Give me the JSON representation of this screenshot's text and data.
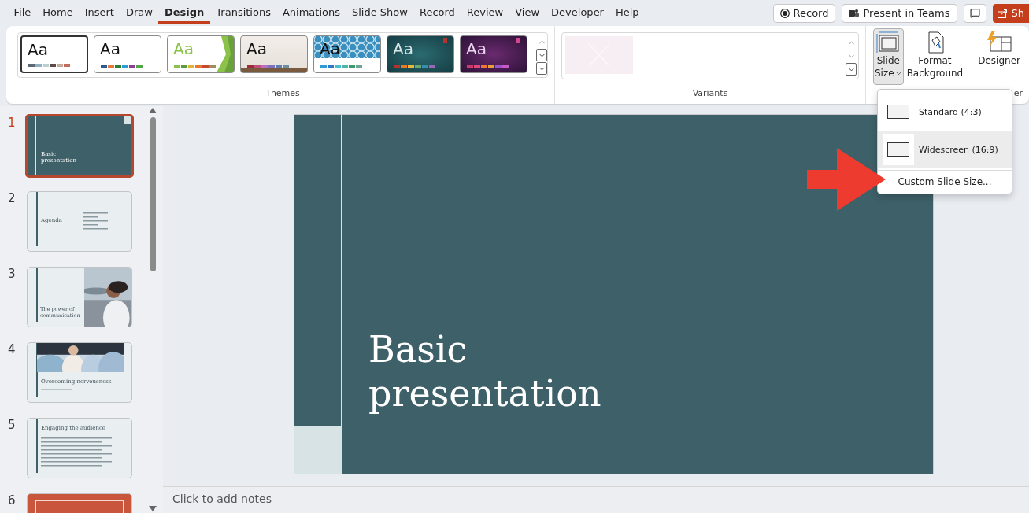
{
  "menu_tabs": [
    {
      "label": "File",
      "selected": false
    },
    {
      "label": "Home",
      "selected": false
    },
    {
      "label": "Insert",
      "selected": false
    },
    {
      "label": "Draw",
      "selected": false
    },
    {
      "label": "Design",
      "selected": true
    },
    {
      "label": "Transitions",
      "selected": false
    },
    {
      "label": "Animations",
      "selected": false
    },
    {
      "label": "Slide Show",
      "selected": false
    },
    {
      "label": "Record",
      "selected": false
    },
    {
      "label": "Review",
      "selected": false
    },
    {
      "label": "View",
      "selected": false
    },
    {
      "label": "Developer",
      "selected": false
    },
    {
      "label": "Help",
      "selected": false
    }
  ],
  "top_buttons": {
    "record": "Record",
    "present": "Present in Teams",
    "share": "Sh"
  },
  "ribbon": {
    "themes": [
      {
        "label": "Aa",
        "selected": true
      },
      {
        "label": "Aa",
        "selected": false
      },
      {
        "label": "Aa",
        "selected": false
      },
      {
        "label": "Aa",
        "selected": false
      },
      {
        "label": "Aa",
        "selected": false
      },
      {
        "label": "Aa",
        "selected": false
      },
      {
        "label": "Aa",
        "selected": false
      }
    ],
    "themes_label": "Themes",
    "variants_label": "Variants",
    "slide_size": {
      "line1": "Slide",
      "line2": "Size",
      "expanded": true
    },
    "format_background": {
      "line1": "Format",
      "line2": "Background"
    },
    "designer": "Designer",
    "designer_group_label": "er"
  },
  "slides": [
    {
      "number": "1",
      "kind": "title",
      "selected": true,
      "title": "Basic presentation"
    },
    {
      "number": "2",
      "kind": "agenda",
      "selected": false,
      "title": "Agenda"
    },
    {
      "number": "3",
      "kind": "image-right",
      "selected": false,
      "title": "The power of communication"
    },
    {
      "number": "4",
      "kind": "image-top",
      "selected": false,
      "title": "Overcoming nervousness"
    },
    {
      "number": "5",
      "kind": "bullets",
      "selected": false,
      "title": "Engaging the audience"
    },
    {
      "number": "6",
      "kind": "accent",
      "selected": false
    }
  ],
  "current_slide": {
    "title": "Basic presentation"
  },
  "notes": {
    "placeholder": "Click to add notes"
  },
  "slide_size_menu": [
    {
      "label": "Standard (4:3)",
      "kind": "option",
      "selected": false
    },
    {
      "label": "Widescreen (16:9)",
      "kind": "option",
      "selected": true
    },
    {
      "label": "Custom Slide Size...",
      "kind": "command"
    }
  ]
}
